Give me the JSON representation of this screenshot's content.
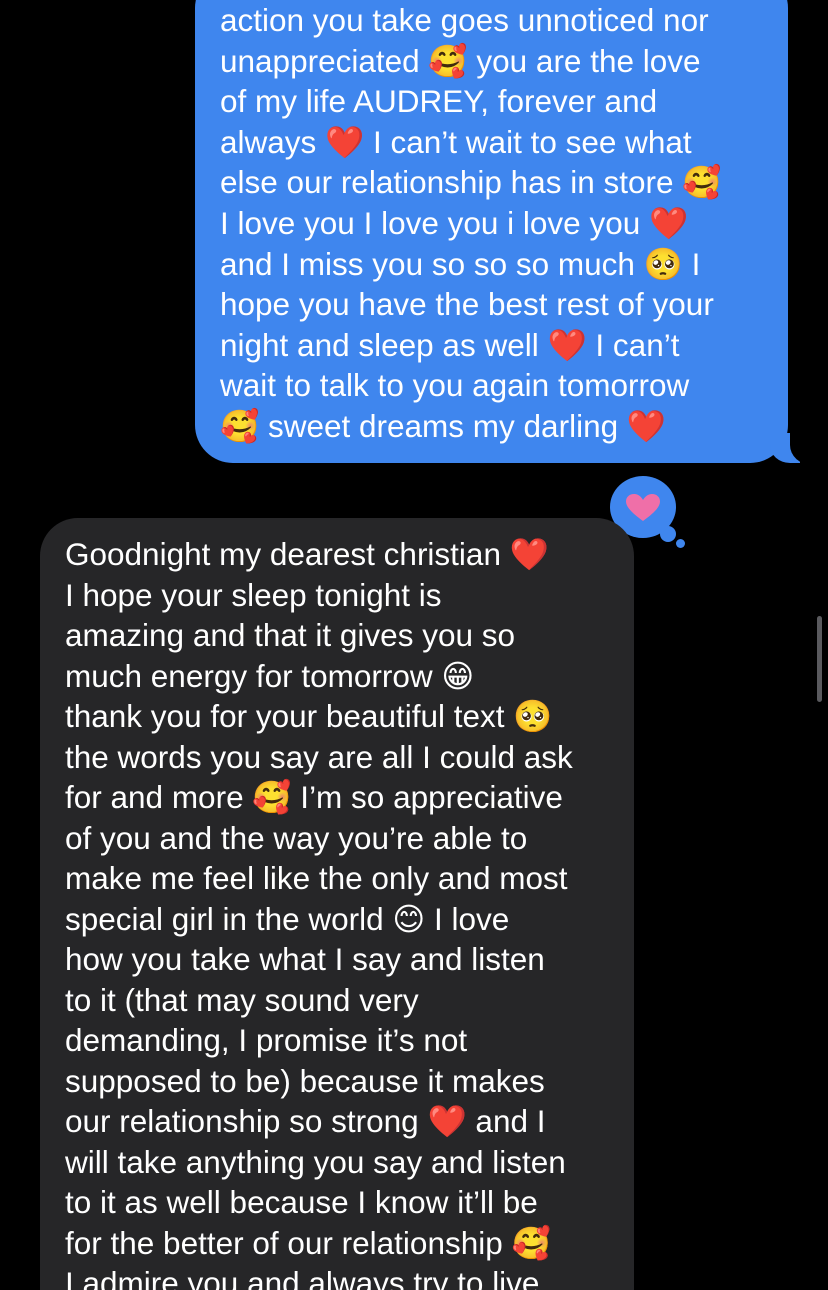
{
  "conversation": {
    "outgoing_message": {
      "text": "action you take goes unnoticed nor\nunappreciated 🥰 you are the love\nof my life AUDREY, forever and\nalways ❤️ I can’t wait to see what\nelse our relationship has in store 🥰\nI love you I love you i love you ❤️\nand I miss you so so so much 🥺 I\nhope you have the best rest of your\nnight and sleep as well ❤️ I can’t\nwait to talk to you again tomorrow\n🥰 sweet dreams my darling ❤️"
    },
    "tapback": {
      "icon": "heart-icon",
      "color": "#ef6fa8"
    },
    "incoming_message": {
      "text": "Goodnight my dearest christian ❤️\nI hope your sleep tonight is\namazing and that it gives you so\nmuch energy for tomorrow 😁\nthank you for your beautiful text 🥺\nthe words you say are all I could ask\nfor and more 🥰 I’m so appreciative\nof you and the way you’re able to\nmake me feel like the only and most\nspecial girl in the world 😊 I love\nhow you take what I say and listen\nto it (that may sound very\ndemanding, I promise it’s not\nsupposed to be) because it makes\nour relationship so strong ❤️ and I\nwill take anything you say and listen\nto it as well because I know it’ll be\nfor the better of our relationship 🥰\nI admire you and always try to live"
    }
  },
  "colors": {
    "background": "#000000",
    "outgoing_bubble": "#3f86ee",
    "incoming_bubble": "#262628",
    "text": "#ffffff"
  }
}
